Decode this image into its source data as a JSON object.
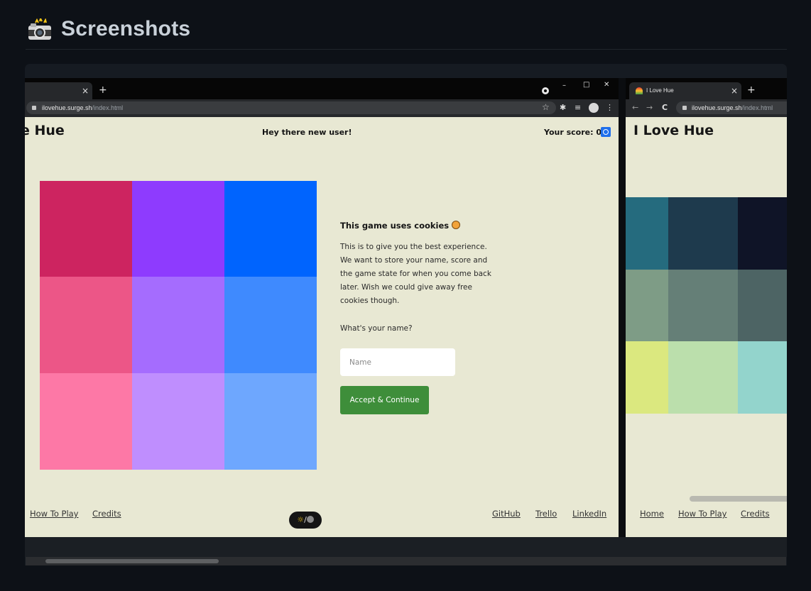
{
  "section": {
    "icon": "camera-icon",
    "title": "Screenshots"
  },
  "colors": {
    "background": "#0d1117",
    "gallery": "#161b22",
    "page": "#e8e8d3",
    "accent_button": "#3e8e3a",
    "score_badge": "#1f6feb"
  },
  "screenshot1": {
    "chrome": {
      "close_tab": "×",
      "new_tab": "+",
      "window_minimize": "–",
      "window_maximize": "□",
      "window_close": "✕",
      "url_host": "ilovehue.surge.sh",
      "url_path": "/index.html",
      "icons": [
        "lock-icon",
        "record-icon",
        "star-icon",
        "extensions-icon",
        "reading-list-icon",
        "profile-icon",
        "menu-icon"
      ]
    },
    "header": {
      "brand": "e Hue",
      "greeting": "Hey there new user!",
      "score_label": "Your score: 0"
    },
    "grid_colors": [
      [
        "#cd2460",
        "#8e3bfe",
        "#0064fe"
      ],
      [
        "#ec5687",
        "#a56cfe",
        "#3f8afe"
      ],
      [
        "#fd78a6",
        "#bf8efe",
        "#6ea7fe"
      ]
    ],
    "modal": {
      "title": "This game uses cookies",
      "title_icon": "cookie-icon",
      "body_lines": [
        "This is to give you the best experience.",
        "We want to store your name, score and",
        "the game state for when you come back",
        "later. Wish we could give away free",
        "cookies though."
      ],
      "question": "What's your name?",
      "name_placeholder": "Name",
      "button": "Accept & Continue"
    },
    "footer": {
      "left_links": [
        "How To Play",
        "Credits"
      ],
      "right_links": [
        "GitHub",
        "Trello",
        "LinkedIn"
      ],
      "theme_toggle": "☼/◉"
    }
  },
  "screenshot2": {
    "chrome": {
      "tab_title": "I Love Hue",
      "tab_icon": "rainbow-icon",
      "close_tab": "×",
      "new_tab": "+",
      "back": "←",
      "forward": "→",
      "reload": "C",
      "url_host": "ilovehue.surge.sh",
      "url_path": "/index.html"
    },
    "header": {
      "brand": "I Love Hue"
    },
    "grid_colors": [
      [
        "#256b7e",
        "#1e3a4d",
        "#0f1427"
      ],
      [
        "#7e9c86",
        "#657f77",
        "#4d6464"
      ],
      [
        "#dbe87f",
        "#bbdfac",
        "#93d4cc"
      ]
    ],
    "footer": {
      "links": [
        "Home",
        "How To Play",
        "Credits"
      ]
    }
  }
}
